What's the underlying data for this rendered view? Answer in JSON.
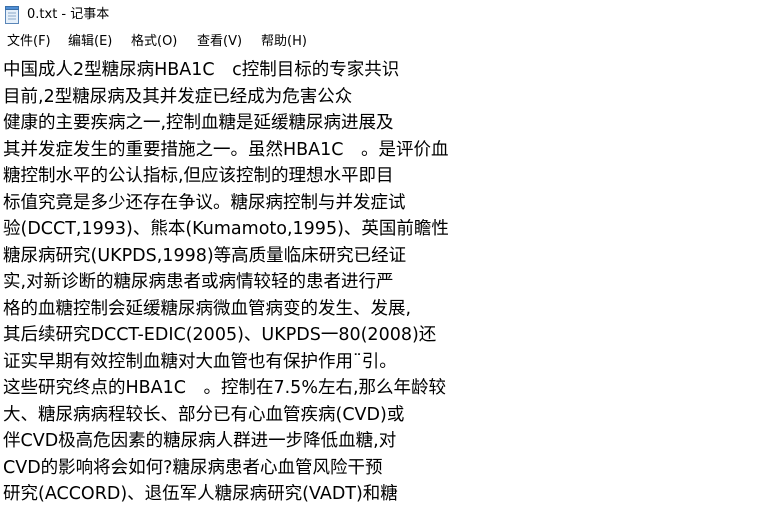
{
  "window": {
    "title": "0.txt - 记事本",
    "icon": "notepad-icon"
  },
  "menu": {
    "file": "文件(F)",
    "edit": "编辑(E)",
    "format": "格式(O)",
    "view": "查看(V)",
    "help": "帮助(H)"
  },
  "document": {
    "text": "中国成人2型糖尿病HBA1C　c控制目标的专家共识\n目前,2型糖尿病及其并发症已经成为危害公众\n健康的主要疾病之一,控制血糖是延缓糖尿病进展及\n其并发症发生的重要措施之一。虽然HBA1C　。是评价血\n糖控制水平的公认指标,但应该控制的理想水平即目\n标值究竟是多少还存在争议。糖尿病控制与并发症试\n验(DCCT,1993)、熊本(Kumamoto,1995)、英国前瞻性\n糖尿病研究(UKPDS,1998)等高质量临床研究已经证\n实,对新诊断的糖尿病患者或病情较轻的患者进行严\n格的血糖控制会延缓糖尿病微血管病变的发生、发展,\n其后续研究DCCT-EDIC(2005)、UKPDS一80(2008)还\n证实早期有效控制血糖对大血管也有保护作用¨引。\n这些研究终点的HBA1C　。控制在7.5%左右,那么年龄较\n大、糖尿病病程较长、部分已有心血管疾病(CVD)或\n伴CVD极高危因素的糖尿病人群进一步降低血糖,对\nCVD的影响将会如何?糖尿病患者心血管风险干预\n研究(ACCORD)、退伍军人糖尿病研究(VADT)和糖"
  }
}
